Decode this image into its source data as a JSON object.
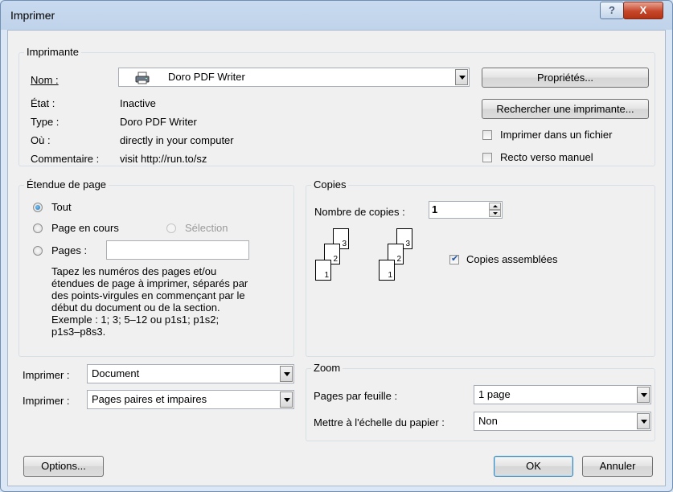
{
  "window": {
    "title": "Imprimer",
    "help_label": "?",
    "close_label": "X"
  },
  "printer": {
    "group_label": "Imprimante",
    "name_label": "Nom :",
    "name_value": "Doro PDF Writer",
    "state_label": "État :",
    "state_value": "Inactive",
    "type_label": "Type :",
    "type_value": "Doro PDF Writer",
    "where_label": "Où :",
    "where_value": "directly in your computer",
    "comment_label": "Commentaire :",
    "comment_value": "visit http://run.to/sz",
    "properties_button": "Propriétés...",
    "find_printer_button": "Rechercher une imprimante...",
    "print_to_file_label": "Imprimer dans un fichier",
    "print_to_file_checked": false,
    "manual_duplex_label": "Recto verso manuel",
    "manual_duplex_checked": false
  },
  "page_range": {
    "group_label": "Étendue de page",
    "all_label": "Tout",
    "current_page_label": "Page en cours",
    "selection_label": "Sélection",
    "pages_label": "Pages :",
    "pages_value": "",
    "selected": "all",
    "help_lines": [
      "Tapez les numéros des pages et/ou",
      "étendues de page à imprimer, séparés par",
      "des points-virgules en commençant par le",
      "début du document ou de la section.",
      "Exemple : 1; 3; 5–12 ou p1s1; p1s2;",
      "p1s3–p8s3."
    ]
  },
  "copies": {
    "group_label": "Copies",
    "count_label": "Nombre de copies :",
    "count_value": "1",
    "collate_label": "Copies assemblées",
    "collate_checked": true,
    "page_numbers": [
      "3",
      "2",
      "1"
    ]
  },
  "print_what": {
    "label": "Imprimer :",
    "value": "Document"
  },
  "print_pages": {
    "label": "Imprimer :",
    "value": "Pages paires et impaires"
  },
  "zoom": {
    "group_label": "Zoom",
    "pages_per_sheet_label": "Pages par feuille :",
    "pages_per_sheet_value": "1 page",
    "scale_label": "Mettre à l'échelle du papier :",
    "scale_value": "Non"
  },
  "footer": {
    "options_button": "Options...",
    "ok_button": "OK",
    "cancel_button": "Annuler"
  }
}
